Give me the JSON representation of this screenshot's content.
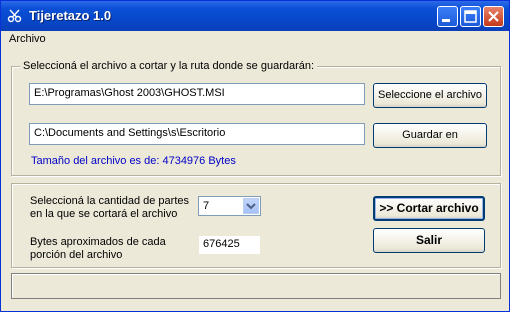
{
  "window": {
    "title": "Tijeretazo 1.0"
  },
  "menu": {
    "items": [
      "Archivo"
    ]
  },
  "file_group": {
    "legend": "Seleccioná el archivo a cortar y la ruta donde se guardarán:",
    "source_path": "E:\\Programas\\Ghost 2003\\GHOST.MSI",
    "select_button": "Seleccione el archivo",
    "dest_path": "C:\\Documents and Settings\\s\\Escritorio",
    "save_button": "Guardar en",
    "size_text": "Tamaño del archivo es de: 4734976 Bytes"
  },
  "split_group": {
    "parts_label_line1": "Seleccioná la cantidad de partes",
    "parts_label_line2": "en la que se cortará el archivo",
    "parts_value": "7",
    "approx_label_line1": "Bytes aproximados de cada",
    "approx_label_line2": "porción del archivo",
    "approx_value": "676425",
    "cut_button": ">> Cortar archivo",
    "exit_button": "Salir"
  },
  "status": {
    "text": ""
  }
}
